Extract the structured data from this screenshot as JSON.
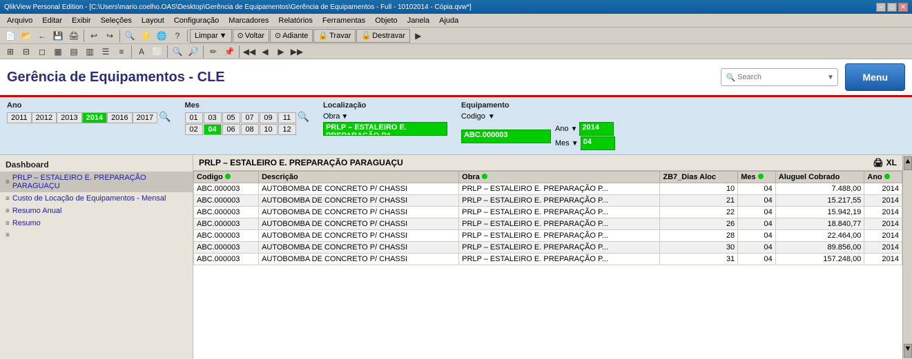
{
  "titleBar": {
    "text": "QlikView Personal Edition - [C:\\Users\\mario.coelho.OAS\\Desktop\\Gerência de Equipamentos\\Gerência de Equipamentos - Full - 10102014 - Cópia.qvw*]",
    "minimize": "−",
    "maximize": "□",
    "close": "✕"
  },
  "menuBar": {
    "items": [
      "Arquivo",
      "Editar",
      "Exibir",
      "Seleções",
      "Layout",
      "Configuração",
      "Marcadores",
      "Relatórios",
      "Ferramentas",
      "Objeto",
      "Janela",
      "Ajuda"
    ]
  },
  "toolbar": {
    "textButtons": [
      "Limpar",
      "Voltar",
      "Adiante",
      "Travar",
      "Destravar"
    ]
  },
  "appHeader": {
    "title": "Gerência de Equipamentos - CLE",
    "search": {
      "placeholder": "Search",
      "value": ""
    },
    "menuButton": "Menu"
  },
  "filters": {
    "ano": {
      "label": "Ano",
      "years": [
        "2011",
        "2012",
        "2013",
        "2014",
        "2016",
        "2017"
      ],
      "active": "2014"
    },
    "mes": {
      "label": "Mes",
      "months": [
        "01",
        "03",
        "05",
        "07",
        "09",
        "11",
        "02",
        "04",
        "06",
        "08",
        "10",
        "12"
      ],
      "active": "04"
    },
    "localizacao": {
      "label": "Localização",
      "obra_label": "Obra",
      "obra_value": "PRLP – ESTALEIRO E. PREPARAÇÃO PA...",
      "dropdown_arrow": "▼"
    },
    "equipamento": {
      "label": "Equipamento",
      "codigo_label": "Codigo",
      "codigo_value": "ABC.000003",
      "ano_label": "Ano",
      "ano_value": "2014",
      "mes_label": "Mes",
      "mes_value": "04",
      "dropdown_arrow": "▼"
    }
  },
  "leftPanel": {
    "title": "Dashboard",
    "items": [
      {
        "icon": "≡",
        "label": "PRLP – ESTALEIRO E. PREPARAÇÃO PARAGUAÇU",
        "active": true
      },
      {
        "icon": "≡",
        "label": "Custo de Locação de Equipamentos - Mensal",
        "active": false
      },
      {
        "icon": "≡",
        "label": "Resumo Anual",
        "active": false
      },
      {
        "icon": "≡",
        "label": "Resumo",
        "active": false
      },
      {
        "icon": "≡",
        "label": "",
        "active": false
      }
    ]
  },
  "tableSection": {
    "title": "PRLP – ESTALEIRO E. PREPARAÇÃO PARAGUAÇU",
    "icons": [
      "🖨",
      "XL"
    ],
    "columns": [
      {
        "key": "codigo",
        "label": "Codigo",
        "dot": "green"
      },
      {
        "key": "descricao",
        "label": "Descrição"
      },
      {
        "key": "obra",
        "label": "Obra",
        "dot": "green"
      },
      {
        "key": "zb7_dias",
        "label": "ZB7_Dias Aloc"
      },
      {
        "key": "mes",
        "label": "Mes",
        "dot": "green"
      },
      {
        "key": "aluguel",
        "label": "Aluguel Cobrado"
      },
      {
        "key": "ano",
        "label": "Ano",
        "dot": "green"
      }
    ],
    "rows": [
      {
        "codigo": "ABC.000003",
        "descricao": "AUTOBOMBA DE CONCRETO P/ CHASSI",
        "obra": "PRLP – ESTALEIRO E. PREPARAÇÃO P...",
        "zb7_dias": "10",
        "mes": "04",
        "aluguel": "7.488,00",
        "ano": "2014"
      },
      {
        "codigo": "ABC.000003",
        "descricao": "AUTOBOMBA DE CONCRETO P/ CHASSI",
        "obra": "PRLP – ESTALEIRO E. PREPARAÇÃO P...",
        "zb7_dias": "21",
        "mes": "04",
        "aluguel": "15.217,55",
        "ano": "2014"
      },
      {
        "codigo": "ABC.000003",
        "descricao": "AUTOBOMBA DE CONCRETO P/ CHASSI",
        "obra": "PRLP – ESTALEIRO E. PREPARAÇÃO P...",
        "zb7_dias": "22",
        "mes": "04",
        "aluguel": "15.942,19",
        "ano": "2014"
      },
      {
        "codigo": "ABC.000003",
        "descricao": "AUTOBOMBA DE CONCRETO P/ CHASSI",
        "obra": "PRLP – ESTALEIRO E. PREPARAÇÃO P...",
        "zb7_dias": "26",
        "mes": "04",
        "aluguel": "18.840,77",
        "ano": "2014"
      },
      {
        "codigo": "ABC.000003",
        "descricao": "AUTOBOMBA DE CONCRETO P/ CHASSI",
        "obra": "PRLP – ESTALEIRO E. PREPARAÇÃO P...",
        "zb7_dias": "28",
        "mes": "04",
        "aluguel": "22.464,00",
        "ano": "2014"
      },
      {
        "codigo": "ABC.000003",
        "descricao": "AUTOBOMBA DE CONCRETO P/ CHASSI",
        "obra": "PRLP – ESTALEIRO E. PREPARAÇÃO P...",
        "zb7_dias": "30",
        "mes": "04",
        "aluguel": "89.856,00",
        "ano": "2014"
      },
      {
        "codigo": "ABC.000003",
        "descricao": "AUTOBOMBA DE CONCRETO P/ CHASSI",
        "obra": "PRLP – ESTALEIRO E. PREPARAÇÃO P...",
        "zb7_dias": "31",
        "mes": "04",
        "aluguel": "157.248,00",
        "ano": "2014"
      }
    ]
  }
}
